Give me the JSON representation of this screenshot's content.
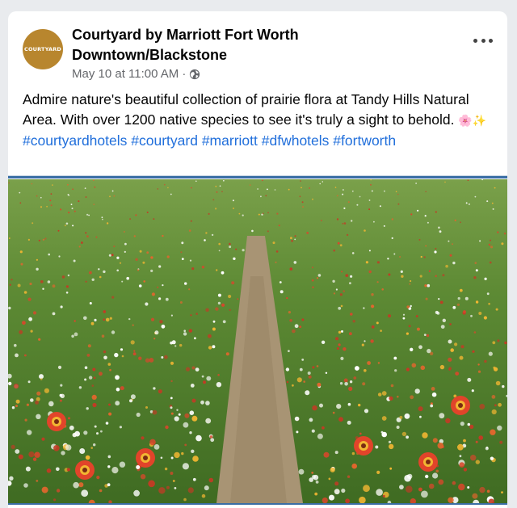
{
  "post": {
    "page_name": "Courtyard by Marriott Fort Worth Downtown/Blackstone",
    "avatar_text": "COURTYARD",
    "timestamp": "May 10 at 11:00 AM",
    "separator": "·",
    "privacy_icon": "globe-icon",
    "more_icon": "more-options-icon",
    "caption_text": "Admire nature's beautiful collection of prairie flora at Tandy Hills Natural Area. With over 1200 native species to see it's truly a sight to behold.",
    "caption_emojis": "🌸✨",
    "hashtags": [
      "#courtyardhotels",
      "#courtyard",
      "#marriott",
      "#dfwhotels",
      "#fortworth"
    ],
    "photo_description_icon": "wildflower-field-photo"
  },
  "colors": {
    "hashtag": "#216fdb",
    "meta_text": "#65676b",
    "avatar_bg": "#b8862e",
    "divider": "#3a6ea5"
  }
}
